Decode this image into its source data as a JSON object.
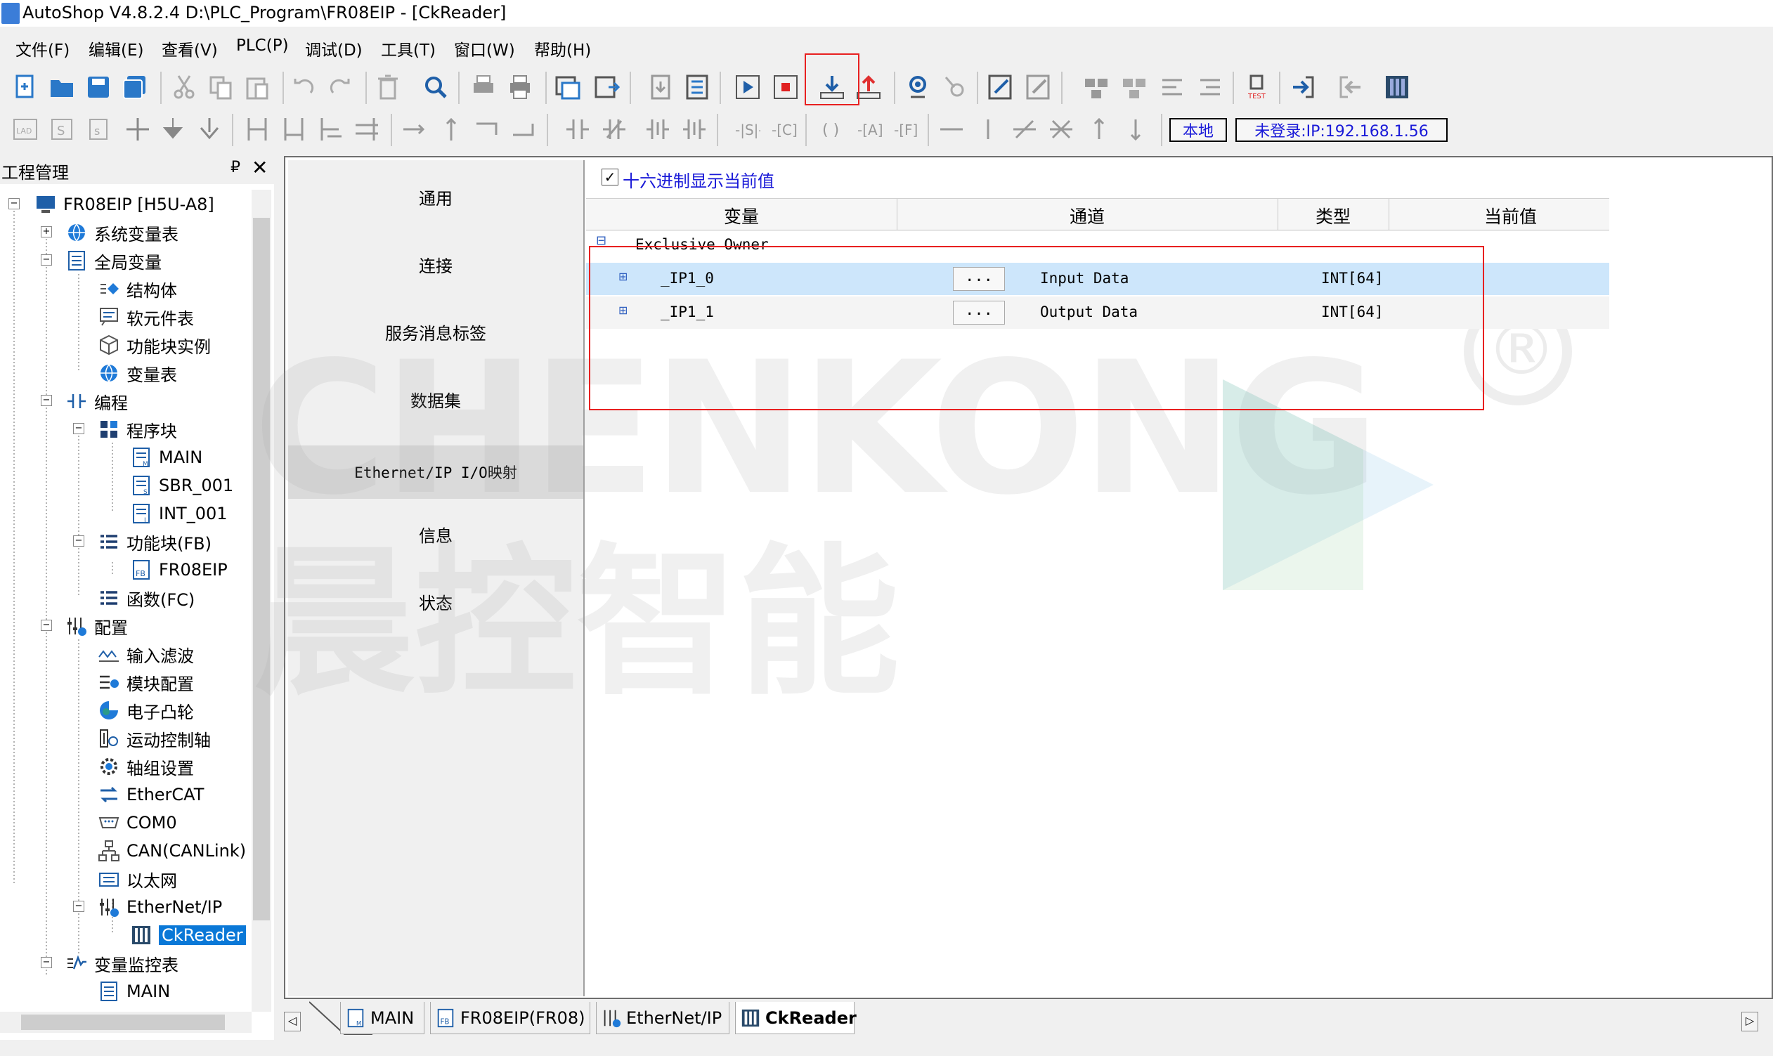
{
  "window": {
    "title": "AutoShop V4.8.2.4  D:\\PLC_Program\\FR08EIP - [CkReader]"
  },
  "menu": [
    "文件(F)",
    "编辑(E)",
    "查看(V)",
    "PLC(P)",
    "调试(D)",
    "工具(T)",
    "窗口(W)",
    "帮助(H)"
  ],
  "status": {
    "local_label": "本地",
    "login_label": "未登录:IP:192.168.1.56"
  },
  "project_panel": {
    "title": "工程管理",
    "pin": "₽",
    "close": "✕",
    "tree": [
      {
        "label": "FR08EIP [H5U-A8]",
        "icon": "pc-icon"
      },
      {
        "label": "系统变量表",
        "icon": "globe-icon"
      },
      {
        "label": "全局变量",
        "icon": "table-icon"
      },
      {
        "label": "结构体",
        "icon": "struct-icon"
      },
      {
        "label": "软元件表",
        "icon": "device-icon"
      },
      {
        "label": "功能块实例",
        "icon": "cube-icon"
      },
      {
        "label": "变量表",
        "icon": "globe-icon"
      },
      {
        "label": "编程",
        "icon": "ladder-icon"
      },
      {
        "label": "程序块",
        "icon": "blocks-icon"
      },
      {
        "label": "MAIN",
        "icon": "program-icon"
      },
      {
        "label": "SBR_001",
        "icon": "program-icon"
      },
      {
        "label": "INT_001",
        "icon": "program-icon"
      },
      {
        "label": "功能块(FB)",
        "icon": "list-icon"
      },
      {
        "label": "FR08EIP",
        "icon": "fb-icon"
      },
      {
        "label": "函数(FC)",
        "icon": "list-icon"
      },
      {
        "label": "配置",
        "icon": "config-icon"
      },
      {
        "label": "输入滤波",
        "icon": "filter-icon"
      },
      {
        "label": "模块配置",
        "icon": "module-icon"
      },
      {
        "label": "电子凸轮",
        "icon": "cam-icon"
      },
      {
        "label": "运动控制轴",
        "icon": "axis-icon"
      },
      {
        "label": "轴组设置",
        "icon": "gear-icon"
      },
      {
        "label": "EtherCAT",
        "icon": "ethercat-icon"
      },
      {
        "label": "COM0",
        "icon": "serial-icon"
      },
      {
        "label": "CAN(CANLink)",
        "icon": "can-icon"
      },
      {
        "label": "以太网",
        "icon": "ethernet-icon"
      },
      {
        "label": "EtherNet/IP",
        "icon": "config-icon"
      },
      {
        "label": "CkReader",
        "icon": "reader-icon"
      },
      {
        "label": "变量监控表",
        "icon": "monitor-icon"
      },
      {
        "label": "MAIN",
        "icon": "table-icon"
      }
    ]
  },
  "nav": [
    "通用",
    "连接",
    "服务消息标签",
    "数据集",
    "Ethernet/IP I/O映射",
    "信息",
    "状态"
  ],
  "hex_display": {
    "checked": true,
    "label": "十六进制显示当前值"
  },
  "table": {
    "columns": [
      "变量",
      "通道",
      "类型",
      "当前值"
    ],
    "group": "Exclusive Owner",
    "rows": [
      {
        "variable": "_IP1_0",
        "button": "...",
        "channel": "Input Data",
        "type": "INT[64]",
        "value": ""
      },
      {
        "variable": "_IP1_1",
        "button": "...",
        "channel": "Output Data",
        "type": "INT[64]",
        "value": ""
      }
    ]
  },
  "watermark": {
    "line1": "CHENKONG",
    "line2": "晨控智能",
    "mark": "®"
  },
  "tabs": [
    "MAIN",
    "FR08EIP(FR08)",
    "EtherNet/IP",
    "CkReader"
  ],
  "colors": {
    "selection": "#0a78d7",
    "highlight_box": "#e82020",
    "row_selected": "#cde6fb",
    "link_blue": "#1a1ad8"
  }
}
